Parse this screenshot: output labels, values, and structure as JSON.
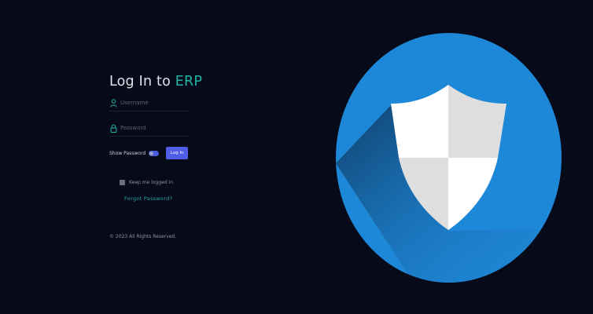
{
  "login": {
    "title_prefix": "Log In to",
    "title_accent": "ERP",
    "username_placeholder": "Username",
    "password_placeholder": "Password",
    "show_password_label": "Show Password",
    "login_button_label": "Log In",
    "keep_logged_in_label": "Keep me logged in",
    "forgot_password_label": "Forgot Password?"
  },
  "footer": {
    "copyright": "© 2023 All Rights Reserved."
  },
  "illustration": {
    "icon": "shield-icon",
    "circle_color": "#1e88d8",
    "shadow_color": "#124a7c"
  },
  "colors": {
    "background": "#070a18",
    "accent": "#1fb6a6",
    "button": "#4f5ee8"
  }
}
